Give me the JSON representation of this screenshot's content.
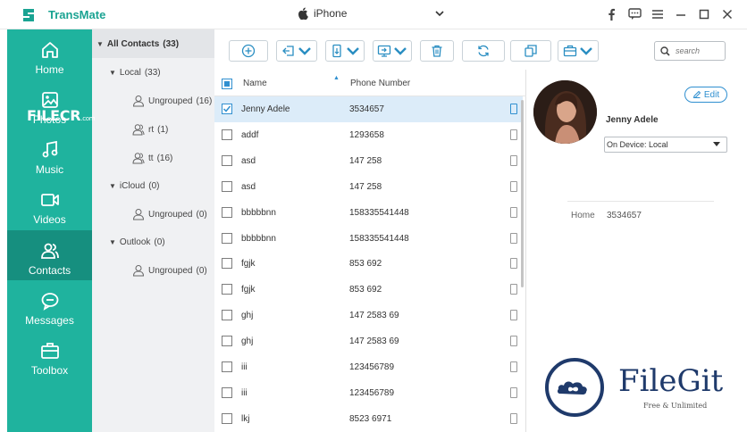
{
  "app": {
    "title": "TransMate",
    "device_name": "iPhone"
  },
  "window_controls": [
    "facebook-icon",
    "feedback-icon",
    "menu-icon",
    "minimize-icon",
    "maximize-icon",
    "close-icon"
  ],
  "sidebar": {
    "items": [
      {
        "label": "Home",
        "icon": "home-icon",
        "active": false
      },
      {
        "label": "Photos",
        "icon": "photo-icon",
        "active": false
      },
      {
        "label": "Music",
        "icon": "music-icon",
        "active": false
      },
      {
        "label": "Videos",
        "icon": "video-icon",
        "active": false
      },
      {
        "label": "Contacts",
        "icon": "contacts-icon",
        "active": true
      },
      {
        "label": "Messages",
        "icon": "messages-icon",
        "active": false
      },
      {
        "label": "Toolbox",
        "icon": "toolbox-icon",
        "active": false
      }
    ]
  },
  "tree": {
    "all": "All Contacts",
    "all_count": "(33)",
    "groups": [
      {
        "label": "Local",
        "count": "(33)",
        "children": [
          {
            "label": "Ungrouped",
            "count": "(16)"
          },
          {
            "label": "rt",
            "count": "(1)"
          },
          {
            "label": "tt",
            "count": "(16)"
          }
        ]
      },
      {
        "label": "iCloud",
        "count": "(0)",
        "children": [
          {
            "label": "Ungrouped",
            "count": "(0)"
          }
        ]
      },
      {
        "label": "Outlook",
        "count": "(0)",
        "children": [
          {
            "label": "Ungrouped",
            "count": "(0)"
          }
        ]
      }
    ]
  },
  "toolbar": {
    "buttons": [
      "add-icon",
      "import-icon",
      "export-to-device-icon",
      "export-to-pc-icon",
      "delete-icon",
      "refresh-icon",
      "deduplicate-icon",
      "toolbox-icon"
    ],
    "search_placeholder": "search"
  },
  "table": {
    "columns": {
      "name": "Name",
      "phone": "Phone Number"
    },
    "rows": [
      {
        "name": "Jenny Adele",
        "phone": "3534657",
        "selected": true
      },
      {
        "name": "addf",
        "phone": "1293658",
        "selected": false
      },
      {
        "name": "asd",
        "phone": "147 258",
        "selected": false
      },
      {
        "name": "asd",
        "phone": "147 258",
        "selected": false
      },
      {
        "name": "bbbbbnn",
        "phone": "158335541448",
        "selected": false
      },
      {
        "name": "bbbbbnn",
        "phone": "158335541448",
        "selected": false
      },
      {
        "name": "fgjk",
        "phone": "853 692",
        "selected": false
      },
      {
        "name": "fgjk",
        "phone": "853 692",
        "selected": false
      },
      {
        "name": "ghj",
        "phone": "147 2583 69",
        "selected": false
      },
      {
        "name": "ghj",
        "phone": "147 2583 69",
        "selected": false
      },
      {
        "name": "iii",
        "phone": "123456789",
        "selected": false
      },
      {
        "name": "iii",
        "phone": "123456789",
        "selected": false
      },
      {
        "name": "lkj",
        "phone": "8523 6971",
        "selected": false
      }
    ]
  },
  "detail": {
    "edit_label": "Edit",
    "contact_name": "Jenny Adele",
    "location": "On Device: Local",
    "field_label": "Home",
    "field_value": "3534657"
  },
  "watermarks": {
    "filecr": "FILECR",
    "filecr_sub": ".com",
    "filegit": "FileGit",
    "filegit_tag": "Free & Unlimited"
  },
  "colors": {
    "accent": "#1fb39e",
    "accent_active": "#168f7f",
    "link": "#2f8fd0",
    "selection": "#dcecf9"
  }
}
